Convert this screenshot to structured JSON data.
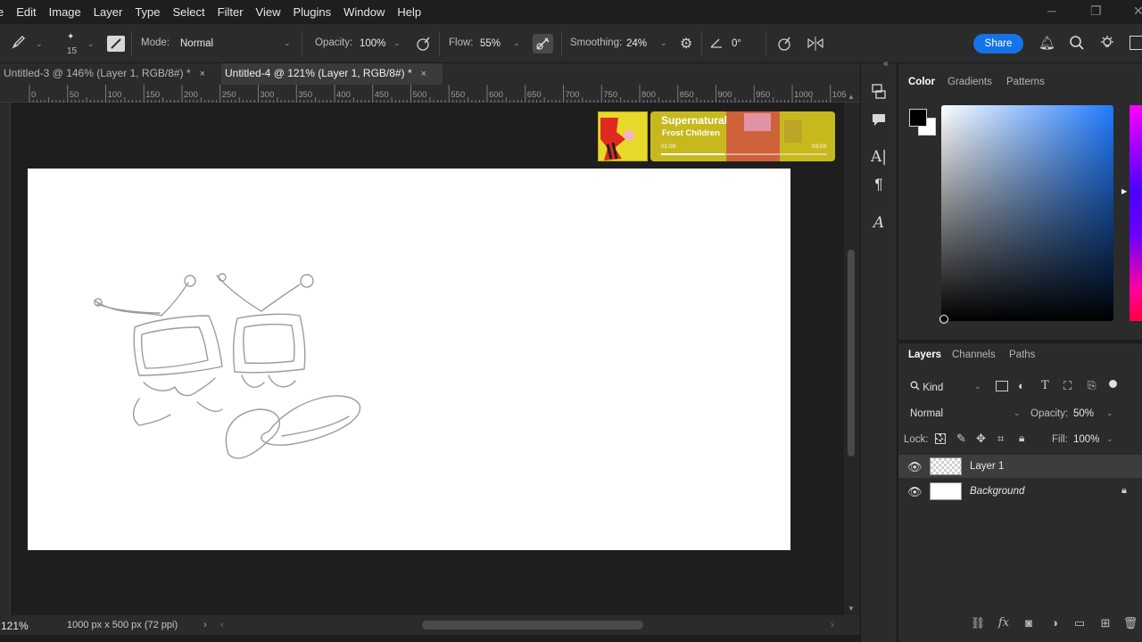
{
  "menu": [
    "e",
    "Edit",
    "Image",
    "Layer",
    "Type",
    "Select",
    "Filter",
    "View",
    "Plugins",
    "Window",
    "Help"
  ],
  "options": {
    "brush_size": "15",
    "mode_label": "Mode:",
    "mode_value": "Normal",
    "opacity_label": "Opacity:",
    "opacity_value": "100%",
    "flow_label": "Flow:",
    "flow_value": "55%",
    "smoothing_label": "Smoothing:",
    "smoothing_value": "24%",
    "angle_value": "0°",
    "share_label": "Share"
  },
  "tabs": [
    {
      "label": "Untitled-3 @ 146% (Layer 1, RGB/8#) *",
      "close": "×"
    },
    {
      "label": "Untitled-4 @ 121% (Layer 1, RGB/8#) *",
      "close": "×"
    }
  ],
  "ruler": [
    "0",
    "50",
    "100",
    "150",
    "200",
    "250",
    "300",
    "350",
    "400",
    "450",
    "500",
    "550",
    "600",
    "650",
    "700",
    "750",
    "800",
    "850",
    "900",
    "950",
    "1000",
    "105"
  ],
  "music": {
    "title": "Supernatural",
    "artist": "Frost Children",
    "elapsed": "01:09",
    "duration": "03:03",
    "progress": 0.38
  },
  "status": {
    "zoom": "121%",
    "doc_size": "1000 px x 500 px (72 ppi)"
  },
  "color_panel": {
    "tabs": [
      "Color",
      "Gradients",
      "Patterns"
    ],
    "foreground": "#000000",
    "background": "#ffffff"
  },
  "layers_panel": {
    "tabs": [
      "Layers",
      "Channels",
      "Paths"
    ],
    "filter_kind": "Kind",
    "blend_mode": "Normal",
    "opacity_label": "Opacity:",
    "opacity_value": "50%",
    "lock_label": "Lock:",
    "fill_label": "Fill:",
    "fill_value": "100%",
    "layers": [
      {
        "name": "Layer 1",
        "visible": true,
        "locked": false
      },
      {
        "name": "Background",
        "visible": true,
        "locked": true
      }
    ]
  },
  "colors": {
    "accent": "#1473e6",
    "panel_bg": "#2b2b2b",
    "workspace_bg": "#1e1e1e"
  }
}
